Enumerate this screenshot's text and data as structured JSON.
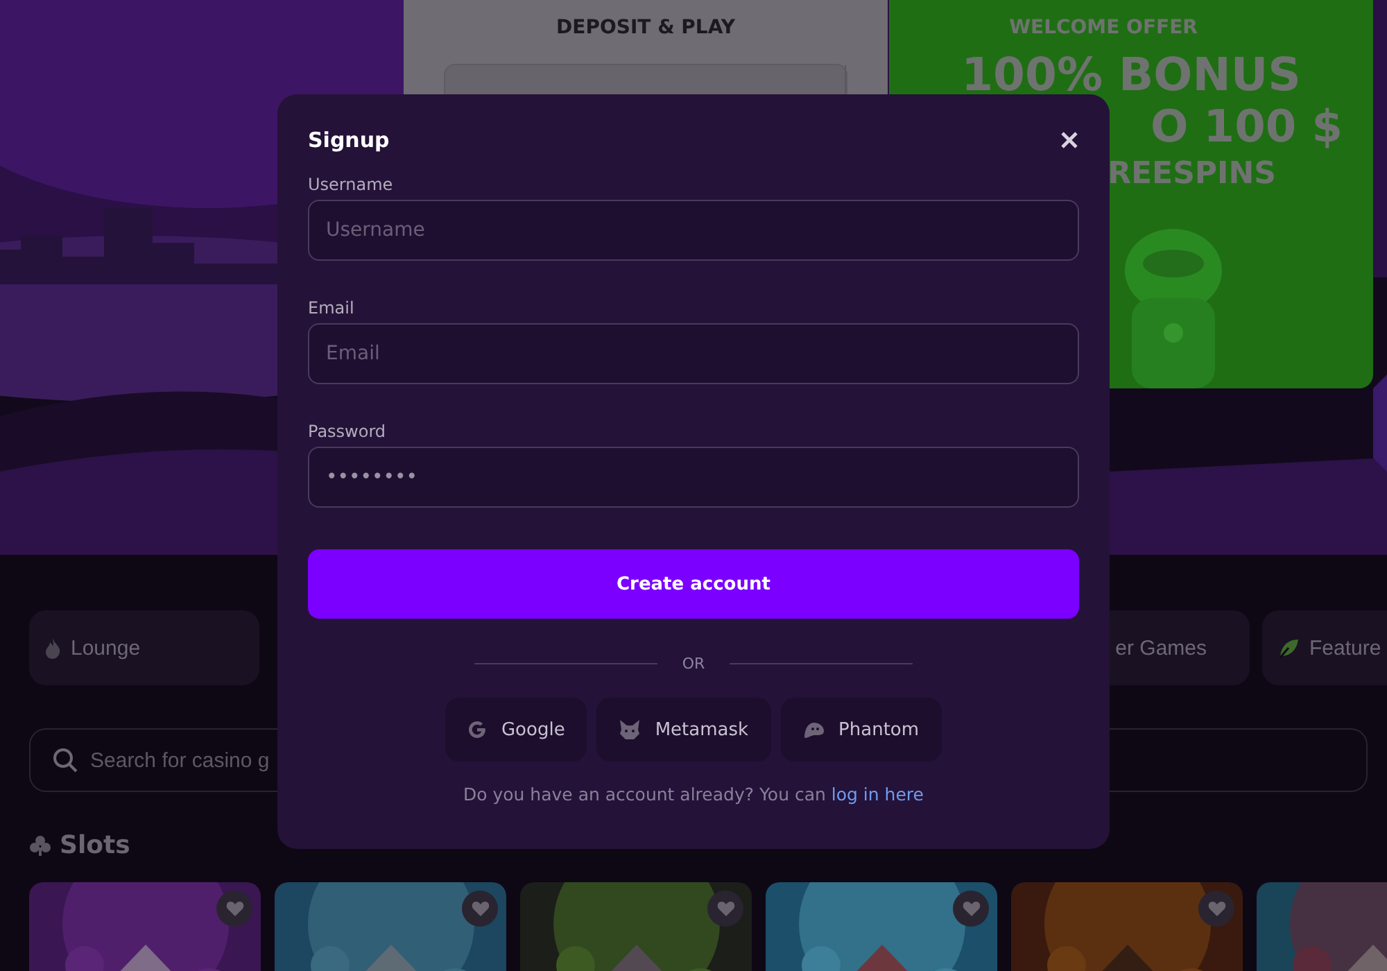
{
  "hero": {
    "deposit_card": {
      "title": "DEPOSIT & PLAY"
    },
    "offer_card": {
      "eyebrow": "WELCOME OFFER",
      "headline": "100% BONUS",
      "amount": "O 100 $",
      "extra": "REESPINS"
    }
  },
  "categories": [
    {
      "label": "Lounge",
      "kind": "lounge"
    },
    {
      "label": "er Games",
      "kind": "games"
    },
    {
      "label": "Feature",
      "kind": "featured"
    }
  ],
  "search": {
    "placeholder": "Search for casino g"
  },
  "section": {
    "title": "Slots"
  },
  "modal": {
    "title": "Signup",
    "fields": [
      {
        "label": "Username",
        "placeholder": "Username"
      },
      {
        "label": "Email",
        "placeholder": "Email"
      },
      {
        "label": "Password",
        "value": "••••••••"
      }
    ],
    "submit": "Create account",
    "divider": "OR",
    "social": [
      {
        "label": "Google",
        "kind": "google"
      },
      {
        "label": "Metamask",
        "kind": "metamask"
      },
      {
        "label": "Phantom",
        "kind": "phantom"
      }
    ],
    "footer": {
      "text": "Do you have an account already? You can ",
      "link": "log in here"
    }
  }
}
